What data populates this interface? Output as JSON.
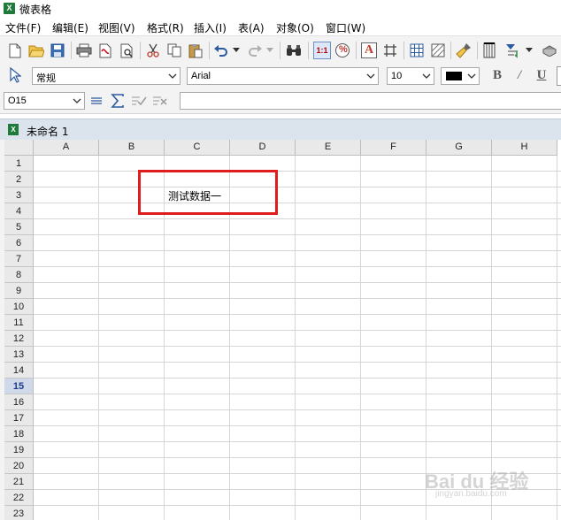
{
  "window": {
    "title": "微表格",
    "app_icon": "spreadsheet-app-icon"
  },
  "menu": [
    "文件(F)",
    "编辑(E)",
    "视图(V)",
    "格式(R)",
    "插入(I)",
    "表(A)",
    "对象(O)",
    "窗口(W)"
  ],
  "toolbar": {
    "icons": [
      "new-document-icon",
      "open-folder-icon",
      "save-icon",
      "print-icon",
      "export-pdf-icon",
      "print-preview-icon",
      "cut-icon",
      "copy-icon",
      "paste-icon",
      "undo-icon",
      "redo-icon",
      "find-icon",
      "zoom-1to1-icon",
      "percent-format-icon",
      "text-color-icon",
      "borders-icon",
      "grid-icon",
      "pattern-fill-icon",
      "clear-format-icon",
      "freeze-panes-icon",
      "sort-icon"
    ],
    "zoom_label": "1:1",
    "percent_label": "%",
    "text_label": "A"
  },
  "format": {
    "style": "常规",
    "font": "Arial",
    "size": "10",
    "color": "#000000",
    "bold": "B",
    "italic": "/",
    "underline": "U"
  },
  "formula_bar": {
    "cell_ref": "O15",
    "formula": ""
  },
  "document": {
    "name": "未命名 1"
  },
  "sheet": {
    "columns": [
      "A",
      "B",
      "C",
      "D",
      "E",
      "F",
      "G",
      "H"
    ],
    "rows": [
      "1",
      "2",
      "3",
      "4",
      "5",
      "6",
      "7",
      "8",
      "9",
      "10",
      "11",
      "12",
      "13",
      "14",
      "15",
      "16",
      "17",
      "18",
      "19",
      "20",
      "21",
      "22",
      "23"
    ],
    "active_row": "15",
    "cell_c3": "测试数据一"
  },
  "watermark": {
    "main": "Bai du 经验",
    "sub": "jingyan.baidu.com"
  },
  "colors": {
    "accent": "#e01d1d",
    "active_header": "#cfd9ea",
    "app_green": "#1e7b3c"
  }
}
